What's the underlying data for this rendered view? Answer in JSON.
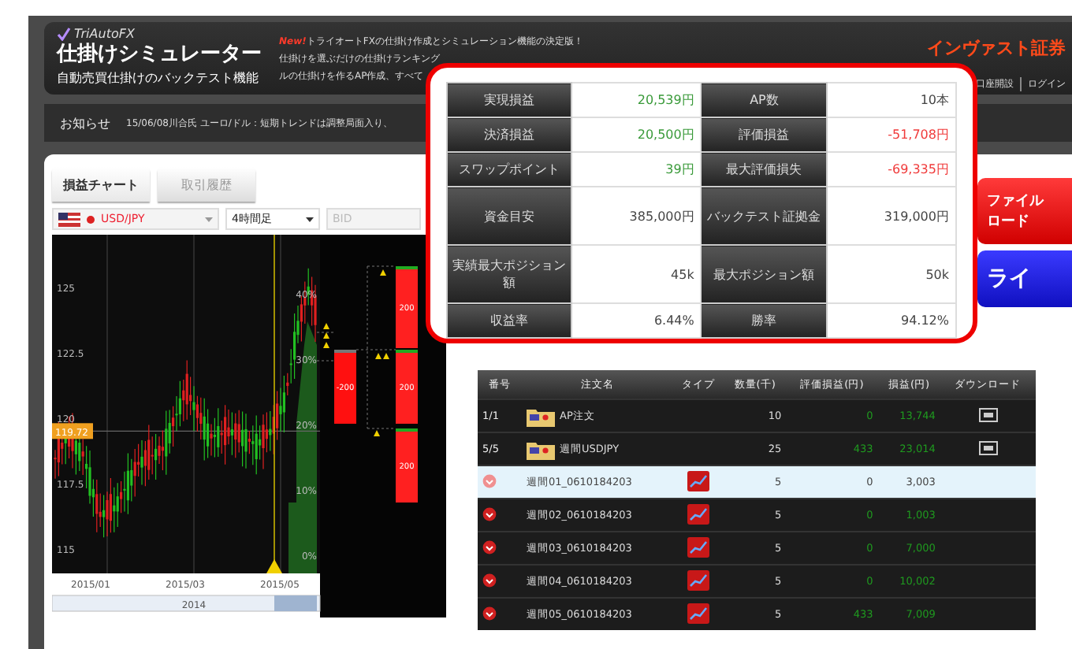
{
  "header": {
    "logo": "TriAutoFX",
    "title": "仕掛けシミュレーター",
    "subtitle": "自動売買仕掛けのバックテスト機能",
    "news": [
      {
        "badge": "New!",
        "text": "トライオートFXの仕掛け作成とシミュレーション機能の決定版！"
      },
      {
        "text": "仕掛けを選ぶだけの仕掛けランキング"
      },
      {
        "text": "ルの仕掛けを作るAP作成、すべて"
      }
    ],
    "brand": "インヴァスト証券",
    "links": [
      "口座開設",
      "ログイン"
    ]
  },
  "notice": {
    "label": "お知らせ",
    "text": "15/06/08川合氏 ユーロ/ドル：短期トレンドは調整局面入り、"
  },
  "left_panel": {
    "tabs": [
      {
        "label": "損益チャート",
        "selected": true
      },
      {
        "label": "取引履歴",
        "selected": false
      }
    ],
    "pair": "USD/JPY",
    "timeframe": "4時間足",
    "price_type": "BID",
    "chart": {
      "y_ticks": [
        "125",
        "122.5",
        "120",
        "117.5",
        "115"
      ],
      "x_ticks": [
        "2015/01",
        "2015/03",
        "2015/05"
      ],
      "percent_ticks": [
        "40%",
        "30%",
        "20%",
        "10%",
        "0%"
      ],
      "price_tag": "119.72",
      "navigator_label": "2014",
      "orders": [
        {
          "kind": "sell",
          "label": "-200"
        },
        {
          "kind": "buy",
          "label": "200"
        },
        {
          "kind": "buy",
          "label": "200"
        },
        {
          "kind": "buy",
          "label": "200"
        }
      ]
    }
  },
  "side_buttons": [
    {
      "kind": "red",
      "lines": [
        "ファイル",
        "ロード"
      ]
    },
    {
      "kind": "blue",
      "lines": [
        "ライ"
      ]
    }
  ],
  "stats": [
    [
      {
        "label": "実現損益",
        "value": "20,539円",
        "kind": "positive"
      },
      {
        "label": "AP数",
        "value": "10本",
        "kind": "neutral"
      }
    ],
    [
      {
        "label": "決済損益",
        "value": "20,500円",
        "kind": "positive"
      },
      {
        "label": "評価損益",
        "value": "-51,708円",
        "kind": "negative"
      }
    ],
    [
      {
        "label": "スワップポイント",
        "value": "39円",
        "kind": "positive"
      },
      {
        "label": "最大評価損失",
        "value": "-69,335円",
        "kind": "negative"
      }
    ],
    [
      {
        "label": "資金目安",
        "value": "385,000円",
        "kind": "neutral"
      },
      {
        "label": "バックテスト証拠金",
        "value": "319,000円",
        "kind": "neutral"
      }
    ],
    [
      {
        "label": "実績最大ポジション額",
        "value": "45k",
        "kind": "neutral"
      },
      {
        "label": "最大ポジション額",
        "value": "50k",
        "kind": "neutral"
      }
    ],
    [
      {
        "label": "収益率",
        "value": "6.44%",
        "kind": "neutral"
      },
      {
        "label": "勝率",
        "value": "94.12%",
        "kind": "neutral"
      }
    ]
  ],
  "orders_table": {
    "columns": [
      "番号",
      "注文名",
      "タイプ",
      "数量(千)",
      "評価損益(円)",
      "損益(円)",
      "ダウンロード"
    ],
    "rows": [
      {
        "kind": "folder",
        "number": "1/1",
        "name": "AP注文",
        "quantity": "10",
        "unrealized": "0",
        "profit": "13,744",
        "selected": false
      },
      {
        "kind": "folder",
        "number": "5/5",
        "name": "週間USDJPY",
        "quantity": "25",
        "unrealized": "433",
        "profit": "23,014",
        "selected": false
      },
      {
        "kind": "order",
        "name": "週間01_0610184203",
        "quantity": "5",
        "unrealized": "0",
        "profit": "3,003",
        "selected": true
      },
      {
        "kind": "order",
        "name": "週間02_0610184203",
        "quantity": "5",
        "unrealized": "0",
        "profit": "1,003",
        "selected": false
      },
      {
        "kind": "order",
        "name": "週間03_0610184203",
        "quantity": "5",
        "unrealized": "0",
        "profit": "7,000",
        "selected": false
      },
      {
        "kind": "order",
        "name": "週間04_0610184203",
        "quantity": "5",
        "unrealized": "0",
        "profit": "10,002",
        "selected": false
      },
      {
        "kind": "order",
        "name": "週間05_0610184203",
        "quantity": "5",
        "unrealized": "433",
        "profit": "7,009",
        "selected": false
      }
    ]
  }
}
